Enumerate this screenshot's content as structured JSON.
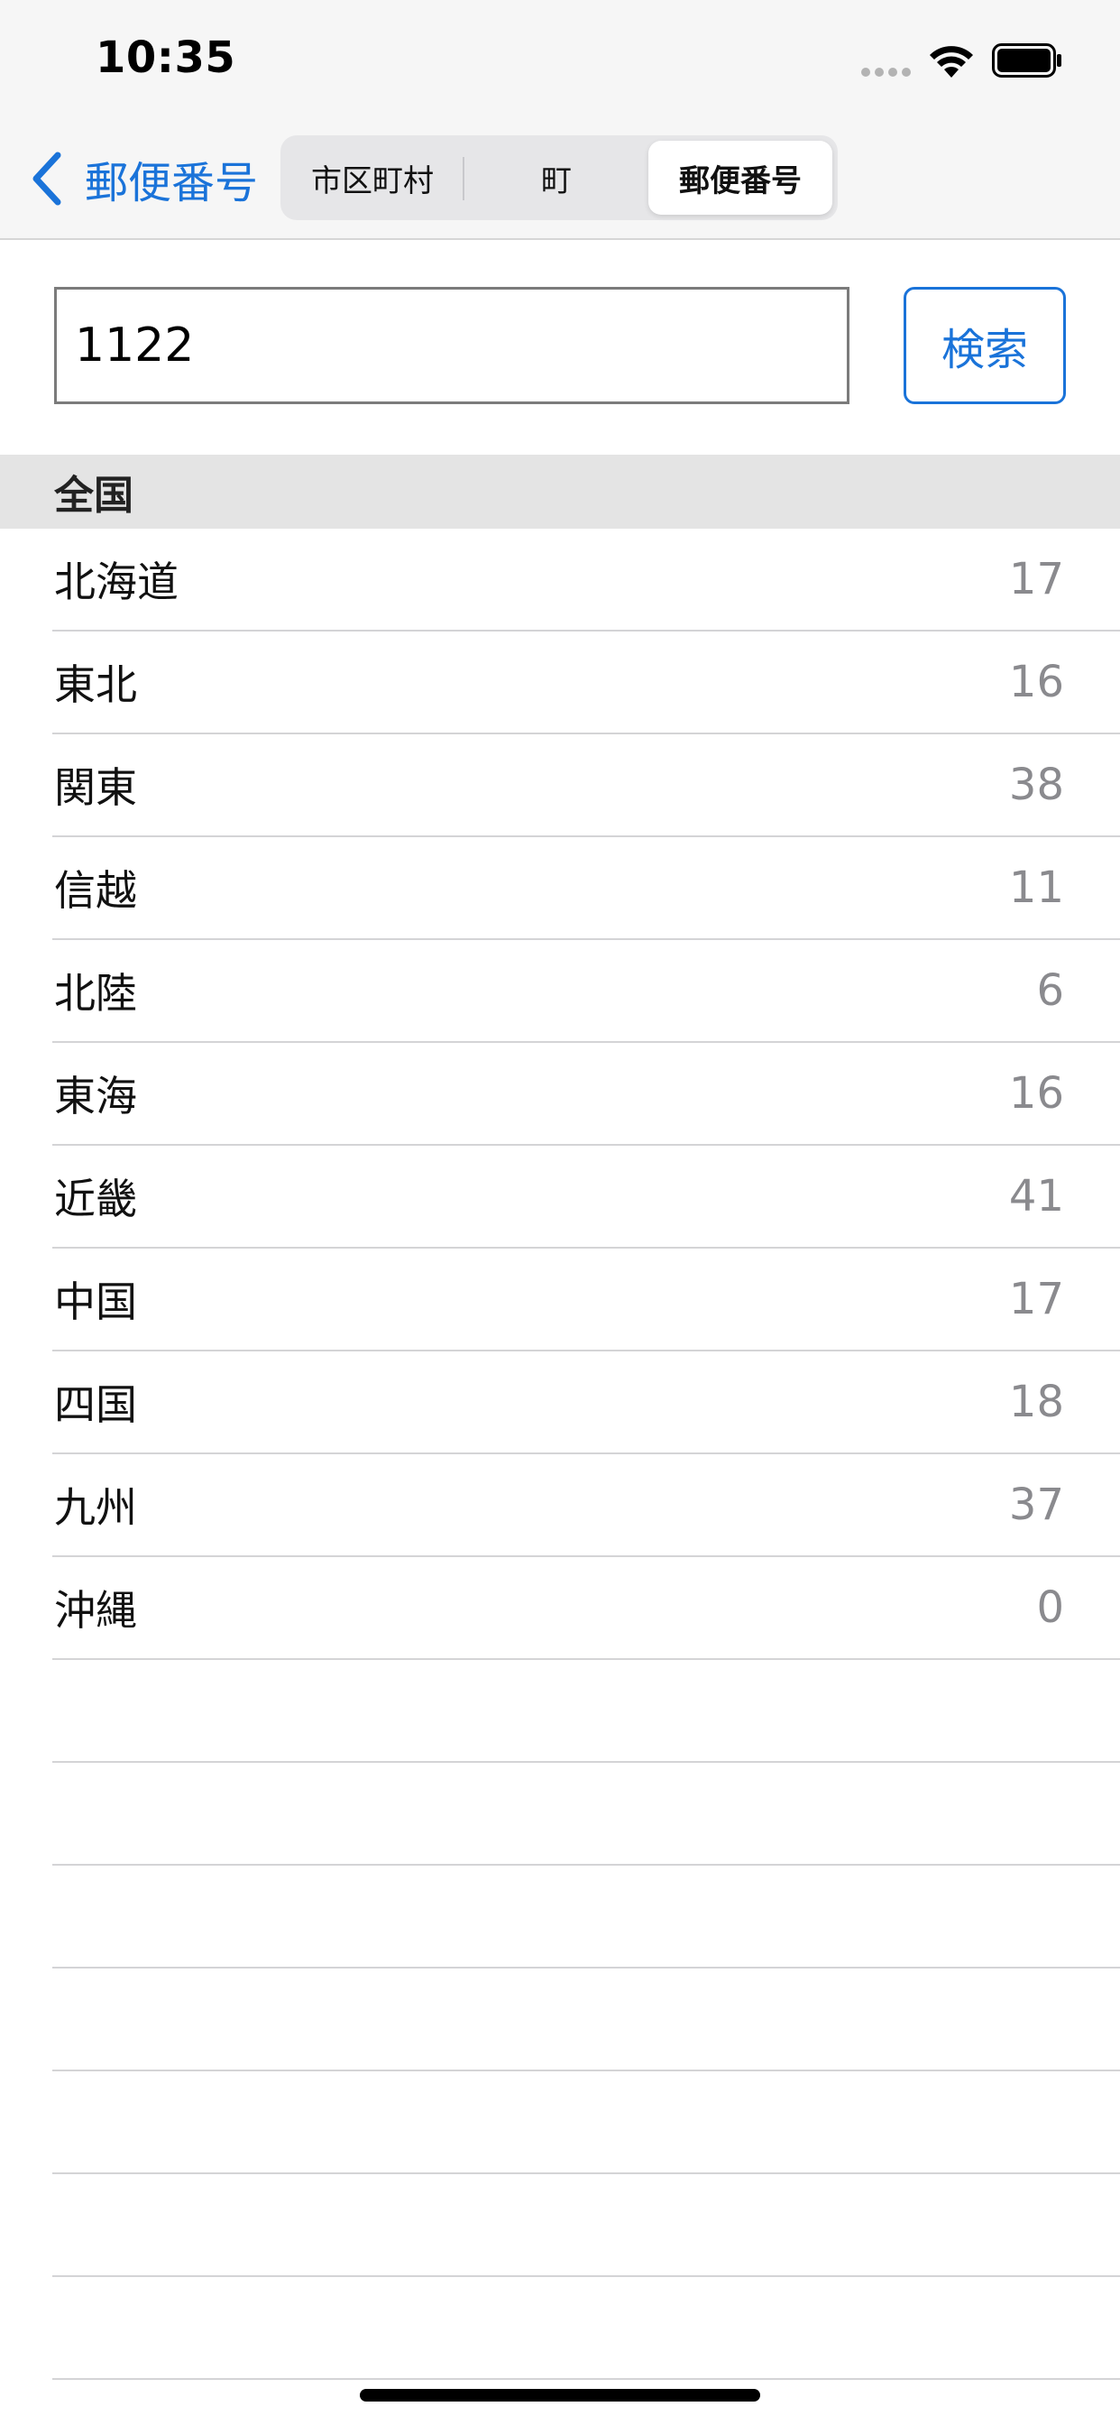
{
  "status_bar": {
    "time": "10:35"
  },
  "nav": {
    "back_label": "郵便番号",
    "segments": [
      "市区町村",
      "町",
      "郵便番号"
    ],
    "selected_segment": "郵便番号"
  },
  "search": {
    "value": "1122",
    "button_label": "検索"
  },
  "section": {
    "header": "全国",
    "rows": [
      {
        "label": "北海道",
        "count": "17"
      },
      {
        "label": "東北",
        "count": "16"
      },
      {
        "label": "関東",
        "count": "38"
      },
      {
        "label": "信越",
        "count": "11"
      },
      {
        "label": "北陸",
        "count": "6"
      },
      {
        "label": "東海",
        "count": "16"
      },
      {
        "label": "近畿",
        "count": "41"
      },
      {
        "label": "中国",
        "count": "17"
      },
      {
        "label": "四国",
        "count": "18"
      },
      {
        "label": "九州",
        "count": "37"
      },
      {
        "label": "沖縄",
        "count": "0"
      }
    ]
  },
  "colors": {
    "accent": "#1a73d9",
    "count_text": "#8a8a8e",
    "section_bg": "#e4e4e4"
  },
  "icons": [
    "wifi-icon",
    "battery-icon",
    "back-chevron-icon"
  ]
}
